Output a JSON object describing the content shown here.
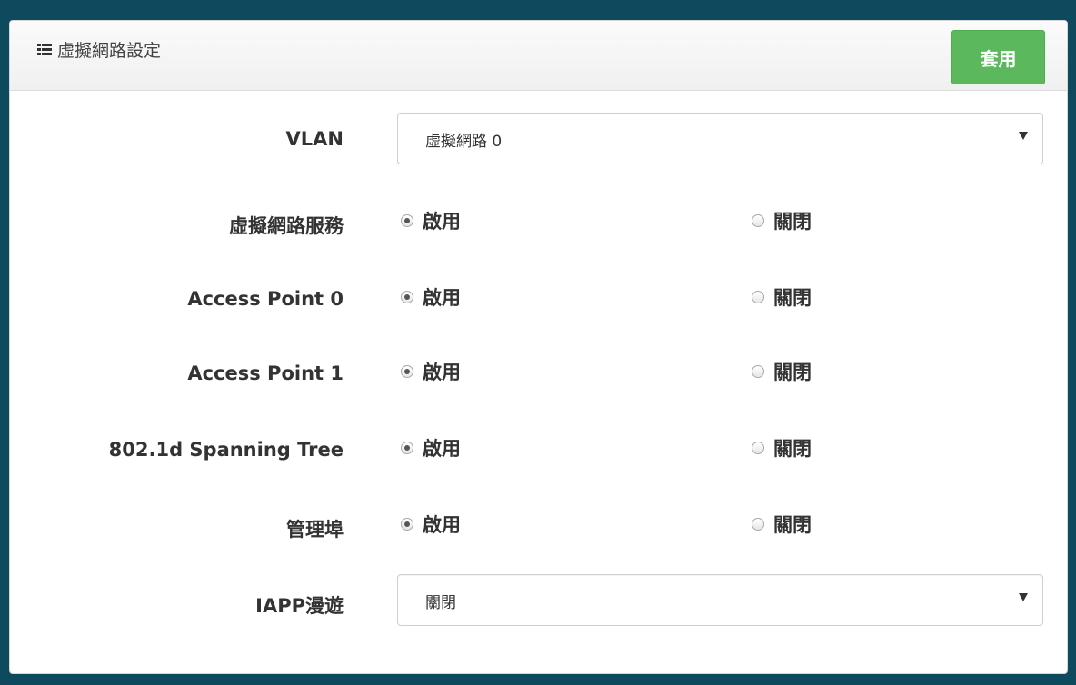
{
  "header": {
    "title": "虛擬網路設定",
    "icon": "list-icon",
    "apply_label": "套用",
    "apply_color": "#5cb85c"
  },
  "vlan": {
    "label": "VLAN",
    "value": "虛擬網路 0"
  },
  "rows": [
    {
      "label": "虛擬網路服務",
      "enable": "啟用",
      "disable": "關閉",
      "selected": "enable"
    },
    {
      "label": "Access Point 0",
      "enable": "啟用",
      "disable": "關閉",
      "selected": "enable"
    },
    {
      "label": "Access Point 1",
      "enable": "啟用",
      "disable": "關閉",
      "selected": "enable"
    },
    {
      "label": "802.1d Spanning Tree",
      "enable": "啟用",
      "disable": "關閉",
      "selected": "enable"
    },
    {
      "label": "管理埠",
      "enable": "啟用",
      "disable": "關閉",
      "selected": "enable"
    }
  ],
  "iapp": {
    "label": "IAPP漫遊",
    "value": "關閉"
  }
}
